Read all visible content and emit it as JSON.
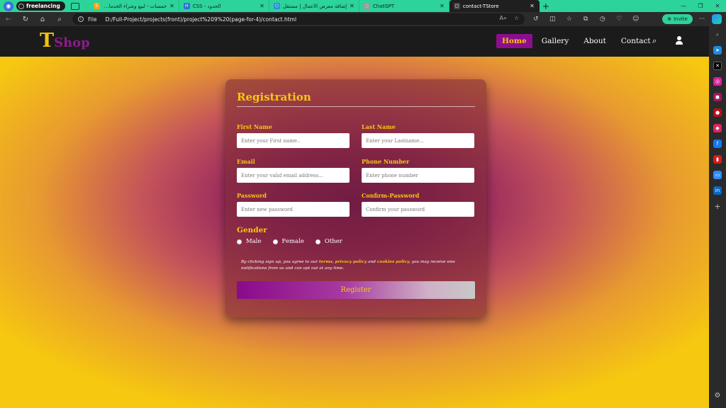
{
  "browser": {
    "workspace": "freelancing",
    "tabs": [
      {
        "title": "خمسات - لبيع وشراء الخدمات المص...",
        "favicon": "5",
        "color": "#f0a41c"
      },
      {
        "title": "CSS - الحدود",
        "favicon": "H",
        "color": "#2e6fd8"
      },
      {
        "title": "إضافة معرض الأعمال | مستقل",
        "favicon": "⬡",
        "color": "#2c8fe0"
      },
      {
        "title": "ChatGPT",
        "favicon": "◌",
        "color": "#777777"
      },
      {
        "title": "contact-TStore",
        "favicon": "▢",
        "color": "#555555"
      }
    ],
    "address": {
      "scheme": "File",
      "path": "D:/Full-Project/projects(front)/project%209%20(page-for-4)/contact.html"
    },
    "invite_label": "Invite"
  },
  "site": {
    "logo_t": "T",
    "logo_shop": "Shop",
    "nav": [
      "Home",
      "Gallery",
      "About",
      "Contact"
    ],
    "active_nav": "Home"
  },
  "form": {
    "title": "Registration",
    "fields": {
      "first_name": {
        "label": "First Name",
        "placeholder": "Enter your First name.."
      },
      "last_name": {
        "label": "Last Name",
        "placeholder": "Enter your Lastname..."
      },
      "email": {
        "label": "Email",
        "placeholder": "Enter your valid email address..."
      },
      "phone": {
        "label": "Phone Number",
        "placeholder": "Enter phone number"
      },
      "password": {
        "label": "Password",
        "placeholder": "Enter new password"
      },
      "confirm_password": {
        "label": "Confirm-Password",
        "placeholder": "Confirm your password"
      }
    },
    "gender": {
      "title": "Gender",
      "options": [
        "Male",
        "Female",
        "Other"
      ]
    },
    "terms": {
      "prefix": "By clicking sign up, you agree to our",
      "terms_link": "terms,",
      "privacy_link": "privacy policy",
      "and": "and",
      "cookies_link": "cookies policy.",
      "suffix": "you may receive sms notifications from us and can opt out at any time."
    },
    "register_label": "Register"
  },
  "colors": {
    "accent_yellow": "#f6c810",
    "accent_purple": "#8c0e8c",
    "browser_green": "#2cd39a"
  }
}
